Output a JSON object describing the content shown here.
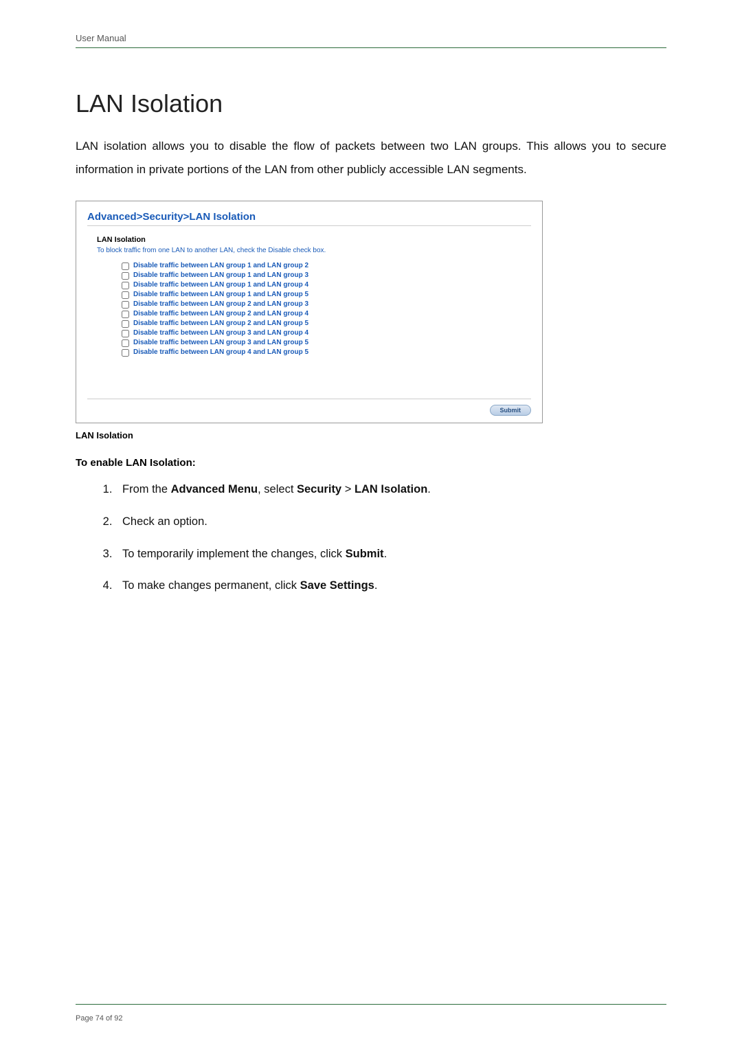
{
  "header": {
    "label": "User Manual"
  },
  "title": "LAN Isolation",
  "intro": "LAN isolation allows you to disable the flow of packets between two LAN groups. This allows you to secure information in private portions of the LAN from other publicly accessible LAN segments.",
  "screenshot": {
    "breadcrumb": "Advanced>Security>LAN Isolation",
    "section_label": "LAN Isolation",
    "section_desc": "To block traffic from one LAN to another LAN, check the Disable check box.",
    "options": [
      "Disable traffic between LAN group 1 and LAN group 2",
      "Disable traffic between LAN group 1 and LAN group 3",
      "Disable traffic between LAN group 1 and LAN group 4",
      "Disable traffic between LAN group 1 and LAN group 5",
      "Disable traffic between LAN group 2 and LAN group 3",
      "Disable traffic between LAN group 2 and LAN group 4",
      "Disable traffic between LAN group 2 and LAN group 5",
      "Disable traffic between LAN group 3 and LAN group 4",
      "Disable traffic between LAN group 3 and LAN group 5",
      "Disable traffic between LAN group 4 and LAN group 5"
    ],
    "submit_label": "Submit"
  },
  "caption": "LAN Isolation",
  "howto_heading": "To enable LAN Isolation:",
  "steps": {
    "s1_pre": "From the ",
    "s1_b1": "Advanced Menu",
    "s1_mid": ", select ",
    "s1_b2": "Security",
    "s1_gt": " > ",
    "s1_b3": "LAN Isolation",
    "s1_end": ".",
    "s2": "Check an option.",
    "s3_pre": "To temporarily implement the changes, click ",
    "s3_b": "Submit",
    "s3_end": ".",
    "s4_pre": "To make changes permanent, click ",
    "s4_b": "Save Settings",
    "s4_end": "."
  },
  "footer": {
    "text": "Page 74 of 92"
  }
}
